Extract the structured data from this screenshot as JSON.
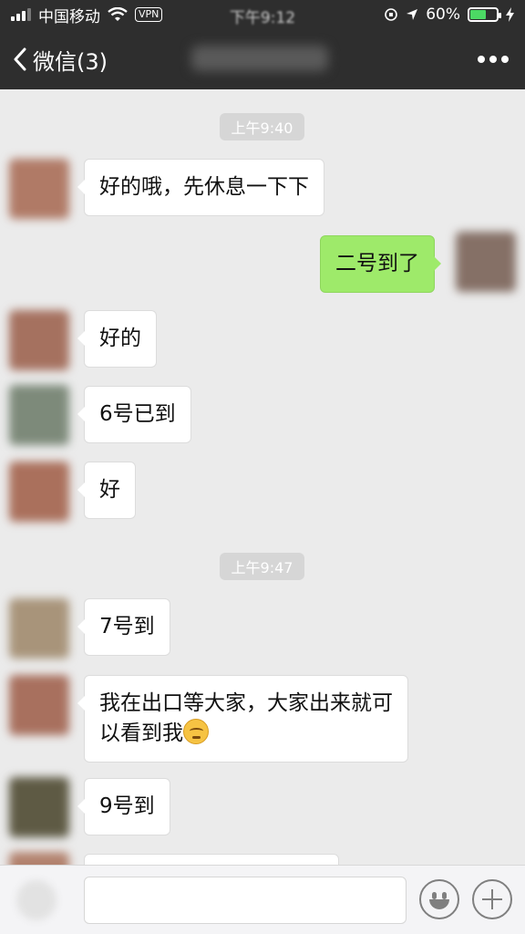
{
  "status_bar": {
    "carrier": "中国移动",
    "vpn": "VPN",
    "time": "下午9:12",
    "battery_percent": "60%",
    "battery_level": 0.6
  },
  "nav": {
    "back_label": "微信(3)",
    "back_icon": "chevron-left-icon",
    "more_icon": "more-dots-icon"
  },
  "chat": {
    "time_1": "上午9:40",
    "time_2": "上午9:47",
    "messages": [
      {
        "side": "left",
        "text": "好的哦，先休息一下下"
      },
      {
        "side": "right",
        "text": "二号到了"
      },
      {
        "side": "left",
        "text": "好的"
      },
      {
        "side": "left",
        "text": "6号已到"
      },
      {
        "side": "left",
        "text": "好"
      },
      {
        "side": "left",
        "text": "7号到"
      },
      {
        "side": "left",
        "line1": "我在出口等大家，大家出来就可",
        "line2": "以看到我",
        "emoji": "smiling-face-emoji"
      },
      {
        "side": "left",
        "text": "9号到"
      }
    ]
  },
  "input_bar": {
    "emoji_icon": "emoji-face-icon",
    "plus_icon": "plus-icon"
  }
}
